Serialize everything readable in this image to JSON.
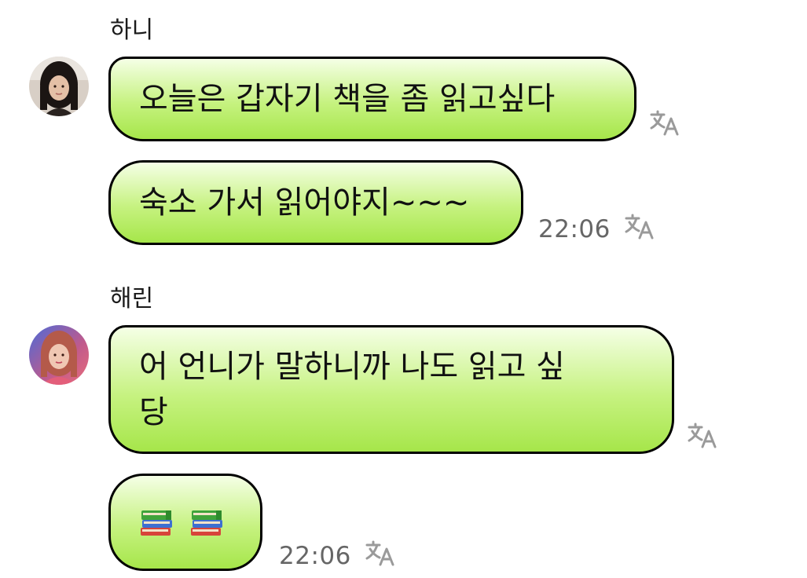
{
  "messages": [
    {
      "sender": "하니",
      "bubbles": [
        {
          "text": "오늘은 갑자기 책을 좀 읽고싶다",
          "time": ""
        },
        {
          "text": "숙소 가서 읽어야지~~~",
          "time": "22:06"
        }
      ]
    },
    {
      "sender": "해린",
      "bubbles": [
        {
          "text": "어 언니가 말하니까 나도 읽고 싶\n당",
          "time": ""
        },
        {
          "emojis": [
            "books-emoji",
            "books-emoji"
          ],
          "time": "22:06"
        }
      ]
    }
  ],
  "icons": {
    "translate": "translate-icon",
    "avatar_hanni": "avatar-icon",
    "avatar_haerin": "avatar-icon"
  },
  "colors": {
    "bubble_top": "#f5ffe6",
    "bubble_bottom": "#a6e64a",
    "bubble_border": "#000000",
    "time_text": "#666666",
    "icon_gray": "#9a9a9a"
  }
}
